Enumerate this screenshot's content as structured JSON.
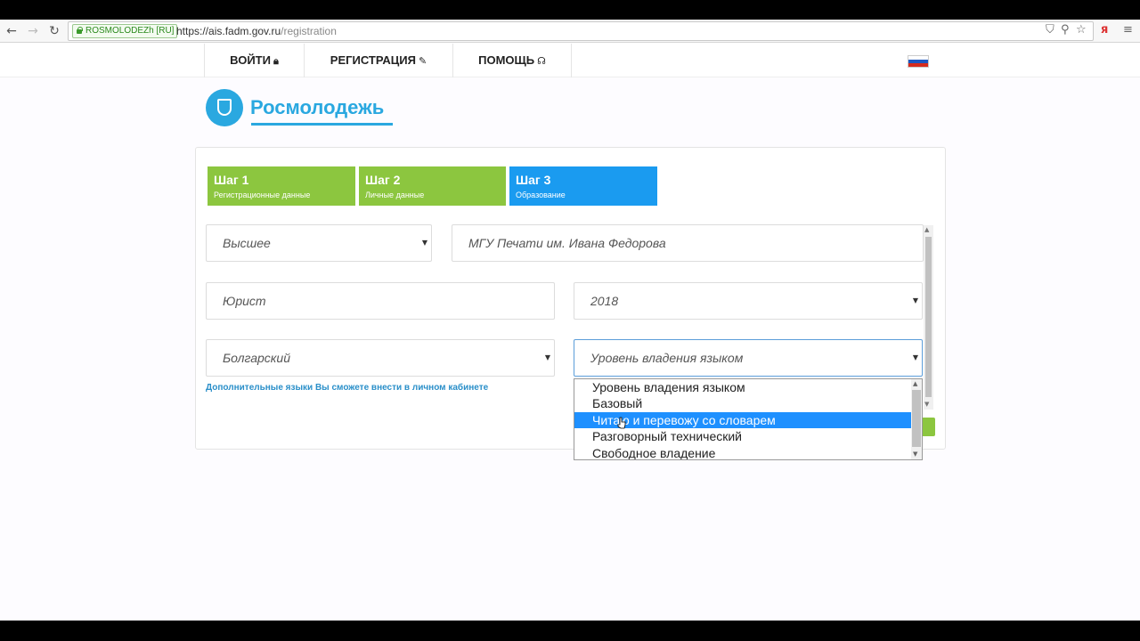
{
  "browser": {
    "site_badge": "ROSMOLODEZh [RU]",
    "url_host": "https://ais.fadm.gov.ru",
    "url_path": "/registration"
  },
  "nav": {
    "login": "ВОЙТИ",
    "register": "РЕГИСТРАЦИЯ",
    "help": "ПОМОЩЬ"
  },
  "logo": {
    "text": "Росмолодежь"
  },
  "steps": [
    {
      "title": "Шаг 1",
      "subtitle": "Регистрационные данные"
    },
    {
      "title": "Шаг 2",
      "subtitle": "Личные данные"
    },
    {
      "title": "Шаг 3",
      "subtitle": "Образование"
    }
  ],
  "form": {
    "education_level": "Высшее",
    "university": "МГУ Печати им. Ивана Федорова",
    "specialty": "Юрист",
    "graduation_year": "2018",
    "language": "Болгарский",
    "language_level_placeholder": "Уровень владения языком",
    "hint": "Дополнительные языки Вы сможете внести в личном кабинете"
  },
  "dropdown": {
    "options": [
      "Уровень владения языком",
      "Базовый",
      "Читаю и перевожу со словарем",
      "Разговорный технический",
      "Свободное владение"
    ],
    "highlighted": "Читаю и перевожу со словарем"
  },
  "colors": {
    "step_done": "#8cc63f",
    "step_active": "#1a9bf0",
    "brand": "#2aa8e0",
    "highlight": "#1e90ff"
  }
}
